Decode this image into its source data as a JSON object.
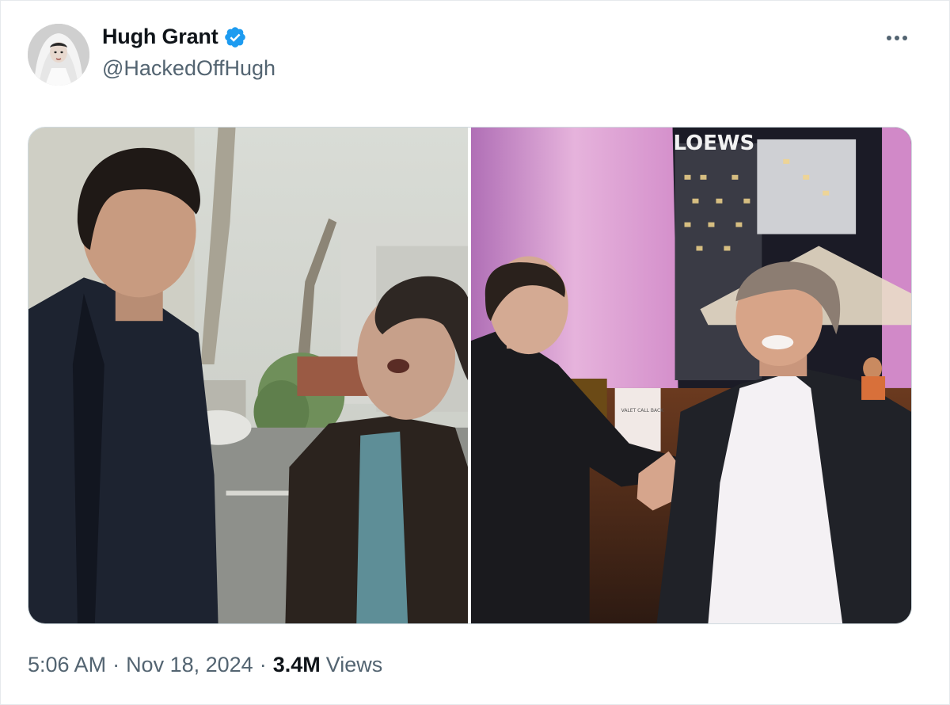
{
  "author": {
    "display_name": "Hugh Grant",
    "handle": "@HackedOffHugh",
    "verified": true,
    "avatar_icon": "avatar-photo",
    "verified_color": "#1d9bf0"
  },
  "header": {
    "more_icon": "ellipsis-icon"
  },
  "media": {
    "photos": [
      {
        "description_icon": "photo-icon"
      },
      {
        "description_icon": "photo-icon",
        "sign_text": "LOEWS",
        "valet_sign": "VALET CALL BACK"
      }
    ]
  },
  "meta": {
    "time": "5:06 AM",
    "separator": "·",
    "date": "Nov 18, 2024",
    "views_count": "3.4M",
    "views_label": "Views"
  },
  "colors": {
    "primary_text": "#0f1419",
    "secondary_text": "#536471",
    "border": "#cfd9de"
  }
}
